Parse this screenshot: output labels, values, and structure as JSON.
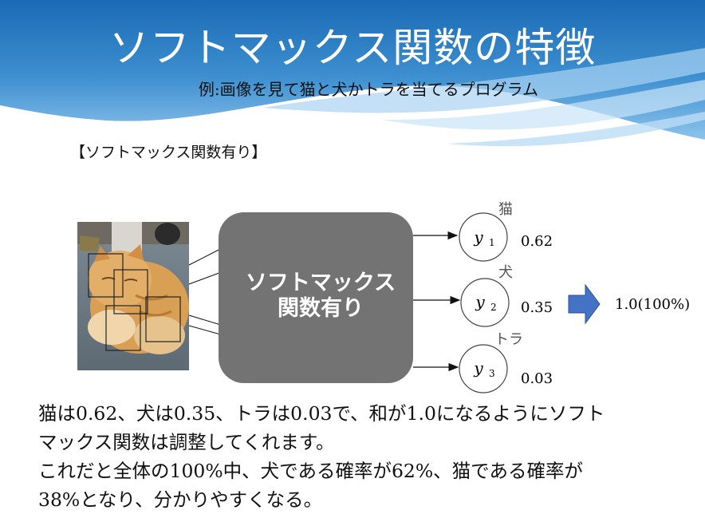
{
  "slide": {
    "title": "ソフトマックス関数の特徴",
    "subtitle": "例:画像を見て猫と犬かトラを当てるプログラム",
    "section_label": "【ソフトマックス関数有り】"
  },
  "diagram": {
    "box_label_line1": "ソフトマックス",
    "box_label_line2": "関数有り",
    "outputs": [
      {
        "class_label": "猫",
        "var": "y",
        "sub": "1",
        "value": "0.62"
      },
      {
        "class_label": "犬",
        "var": "y",
        "sub": "2",
        "value": "0.35"
      },
      {
        "class_label": "トラ",
        "var": "y",
        "sub": "3",
        "value": "0.03"
      }
    ],
    "total": "1.0(100%)",
    "colors": {
      "box": "#737373",
      "arrow_fill": "#4472c4",
      "header_blue": "#2f7fc4"
    },
    "icons": [
      "cat-photo",
      "right-arrow-icon"
    ]
  },
  "body": {
    "lines": [
      "猫は0.62、犬は0.35、トラは0.03で、和が1.0になるようにソフト",
      "マックス関数は調整してくれます。",
      "これだと全体の100%中、犬である確率が62%、猫である確率が",
      "38%となり、分かりやすくなる。"
    ]
  }
}
